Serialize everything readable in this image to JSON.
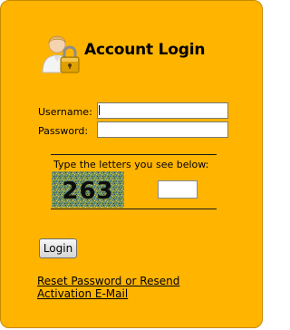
{
  "header": {
    "title": "Account Login",
    "icon": "user-lock-icon"
  },
  "form": {
    "username_label": "Username:",
    "username_value": "",
    "password_label": "Password:",
    "password_value": ""
  },
  "captcha": {
    "prompt": "Type the letters you see below:",
    "image_text": "263",
    "input_value": ""
  },
  "actions": {
    "login_label": "Login",
    "reset_link": "Reset Password or Resend Activation E-Mail"
  },
  "colors": {
    "panel_background": "#ffb400",
    "text": "#000000"
  }
}
